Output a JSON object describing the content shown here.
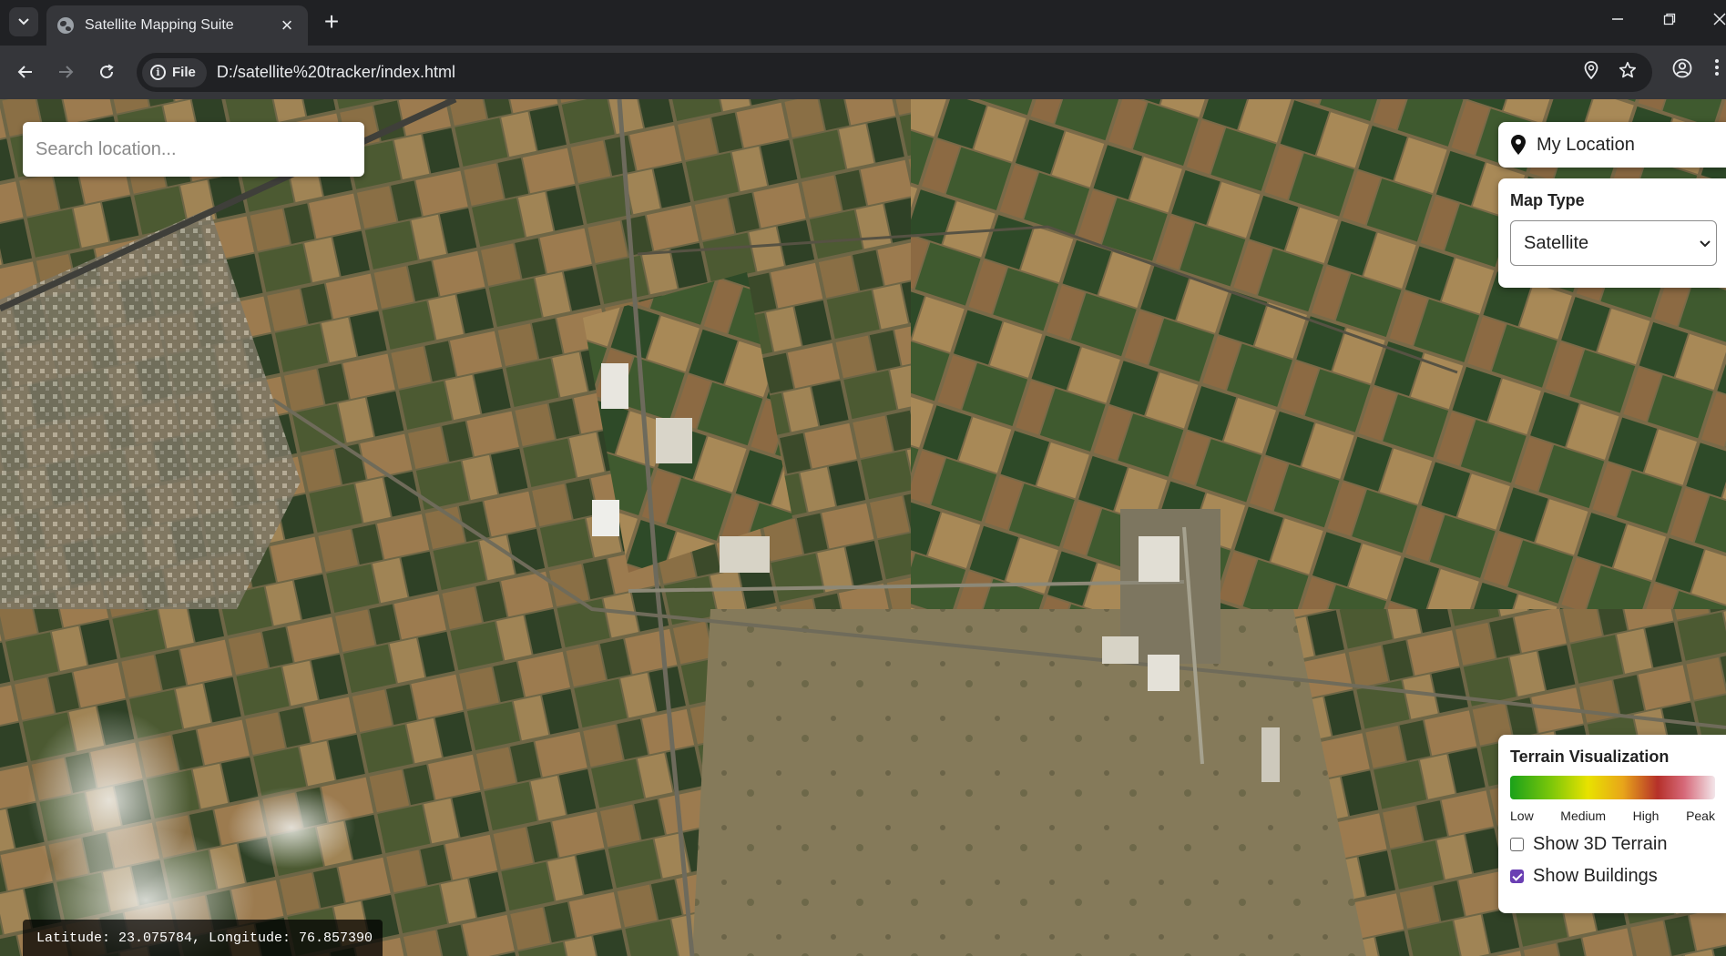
{
  "browser": {
    "tab_title": "Satellite Mapping Suite",
    "new_tab_symbol": "+",
    "close_symbol": "×",
    "security_chip": "File",
    "url": "D:/satellite%20tracker/index.html"
  },
  "map": {
    "search_placeholder": "Search location...",
    "my_location_label": "My Location",
    "map_type": {
      "title": "Map Type",
      "selected": "Satellite"
    },
    "terrain": {
      "title": "Terrain Visualization",
      "legend": [
        "Low",
        "Medium",
        "High",
        "Peak"
      ],
      "colors": [
        "#1aa11a",
        "#e8e200",
        "#b5302a",
        "#f3e6ea"
      ],
      "show_3d_terrain_label": "Show 3D Terrain",
      "show_3d_terrain_checked": false,
      "show_buildings_label": "Show Buildings",
      "show_buildings_checked": true
    },
    "coordinates_text": "Latitude: 23.075784, Longitude: 76.857390"
  },
  "icons": [
    "tab-list-icon",
    "globe-favicon-icon",
    "close-icon",
    "plus-icon",
    "minimize-icon",
    "restore-icon",
    "back-arrow-icon",
    "forward-arrow-icon",
    "reload-icon",
    "info-icon",
    "location-pin-icon",
    "star-icon",
    "profile-icon",
    "more-vert-icon",
    "map-pin-icon"
  ]
}
